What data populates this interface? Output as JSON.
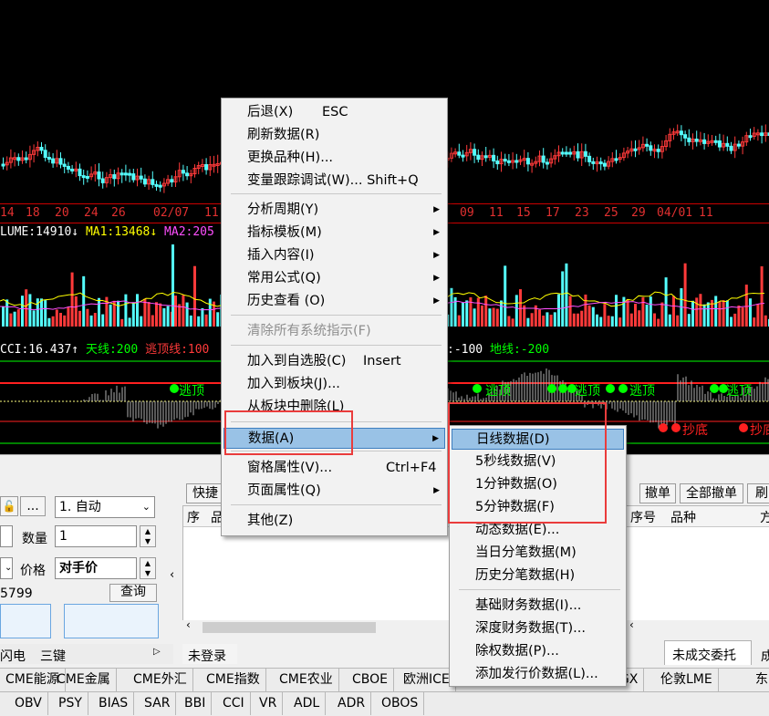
{
  "chart": {
    "dates_left": [
      "14",
      "18",
      "20",
      "24",
      "26",
      "02/07",
      "11"
    ],
    "dates_right": [
      "09",
      "11",
      "15",
      "17",
      "23",
      "25",
      "29",
      "04/01",
      "11"
    ],
    "volume_text": "LUME:14910",
    "ma1_text": "MA1:13468",
    "ma2_text": "MA2:205",
    "cci_text": "CCI:16.437",
    "sky_text": "天线:200",
    "escape_text": "逃顶线:100",
    "neg100_text": ":-100",
    "ground_text": "地线:-200",
    "signal_escape": "逃顶",
    "signal_bottom1": "抄底",
    "signal_bottom2": "抄底",
    "colors": {
      "up": "#ff3a3a",
      "down": "#54ffff",
      "ma1": "#ffff00",
      "ma2": "#ff4fff",
      "green": "#00ff00",
      "red": "#ff2020"
    }
  },
  "context_menu": {
    "items": [
      {
        "label": "后退(X)",
        "shortcut": "ESC"
      },
      {
        "label": "刷新数据(R)",
        "shortcut": ""
      },
      {
        "label": "更换品种(H)...",
        "shortcut": ""
      },
      {
        "label": "变量跟踪调试(W)... Shift+Q",
        "shortcut": ""
      },
      {
        "label": "分析周期(Y)",
        "shortcut": ""
      },
      {
        "label": "指标模板(M)",
        "shortcut": ""
      },
      {
        "label": "插入内容(I)",
        "shortcut": ""
      },
      {
        "label": "常用公式(Q)",
        "shortcut": ""
      },
      {
        "label": "历史查看 (O)",
        "shortcut": ""
      },
      {
        "label": "清除所有系统指示(F)",
        "shortcut": ""
      },
      {
        "label": "加入到自选股(C)",
        "shortcut": "Insert"
      },
      {
        "label": "加入到板块(J)...",
        "shortcut": ""
      },
      {
        "label": "从板块中删除(L)",
        "shortcut": ""
      },
      {
        "label": "数据(A)",
        "shortcut": ""
      },
      {
        "label": "窗格属性(V)...",
        "shortcut": "Ctrl+F4"
      },
      {
        "label": "页面属性(Q)",
        "shortcut": ""
      },
      {
        "label": "其他(Z)",
        "shortcut": ""
      }
    ]
  },
  "submenu": {
    "items": [
      {
        "label": "日线数据(D)"
      },
      {
        "label": "5秒线数据(V)"
      },
      {
        "label": "1分钟数据(O)"
      },
      {
        "label": "5分钟数据(F)"
      },
      {
        "label": "动态数据(E)..."
      },
      {
        "label": "当日分笔数据(M)"
      },
      {
        "label": "历史分笔数据(H)"
      },
      {
        "label": "基础财务数据(I)..."
      },
      {
        "label": "深度财务数据(T)..."
      },
      {
        "label": "除权数据(P)..."
      },
      {
        "label": "添加发行价数据(L)..."
      }
    ]
  },
  "trade_panel": {
    "dots_label": "...",
    "mode_value": "1. 自动",
    "qty_label": "数量",
    "qty_value": "1",
    "price_label": "价格",
    "price_value": "对手价",
    "account_tail": "5799",
    "query_button": "查询",
    "quick_label": "快捷",
    "col_seq": "序",
    "col_item": "品",
    "cancel_button": "撤单",
    "cancel_all_button": "全部撤单",
    "refresh_button": "刷",
    "col_seq2": "序号",
    "col_item2": "品种",
    "col_dir": "方",
    "not_logged": "未登录",
    "tab_left1": "闪电",
    "tab_left2": "三键",
    "tab_unfilled": "未成交委托",
    "tab_right_cut": "成"
  },
  "markets_bar": [
    "CME能源",
    "CME金属",
    "CME外汇",
    "CME指数",
    "CME农业",
    "CBOE",
    "欧洲ICE",
    "",
    "坡SGX",
    "伦敦LME",
    "东"
  ],
  "indicator_bar": [
    "OBV",
    "PSY",
    "BIAS",
    "SAR",
    "BBI",
    "CCI",
    "VR",
    "ADL",
    "ADR",
    "OBOS"
  ]
}
